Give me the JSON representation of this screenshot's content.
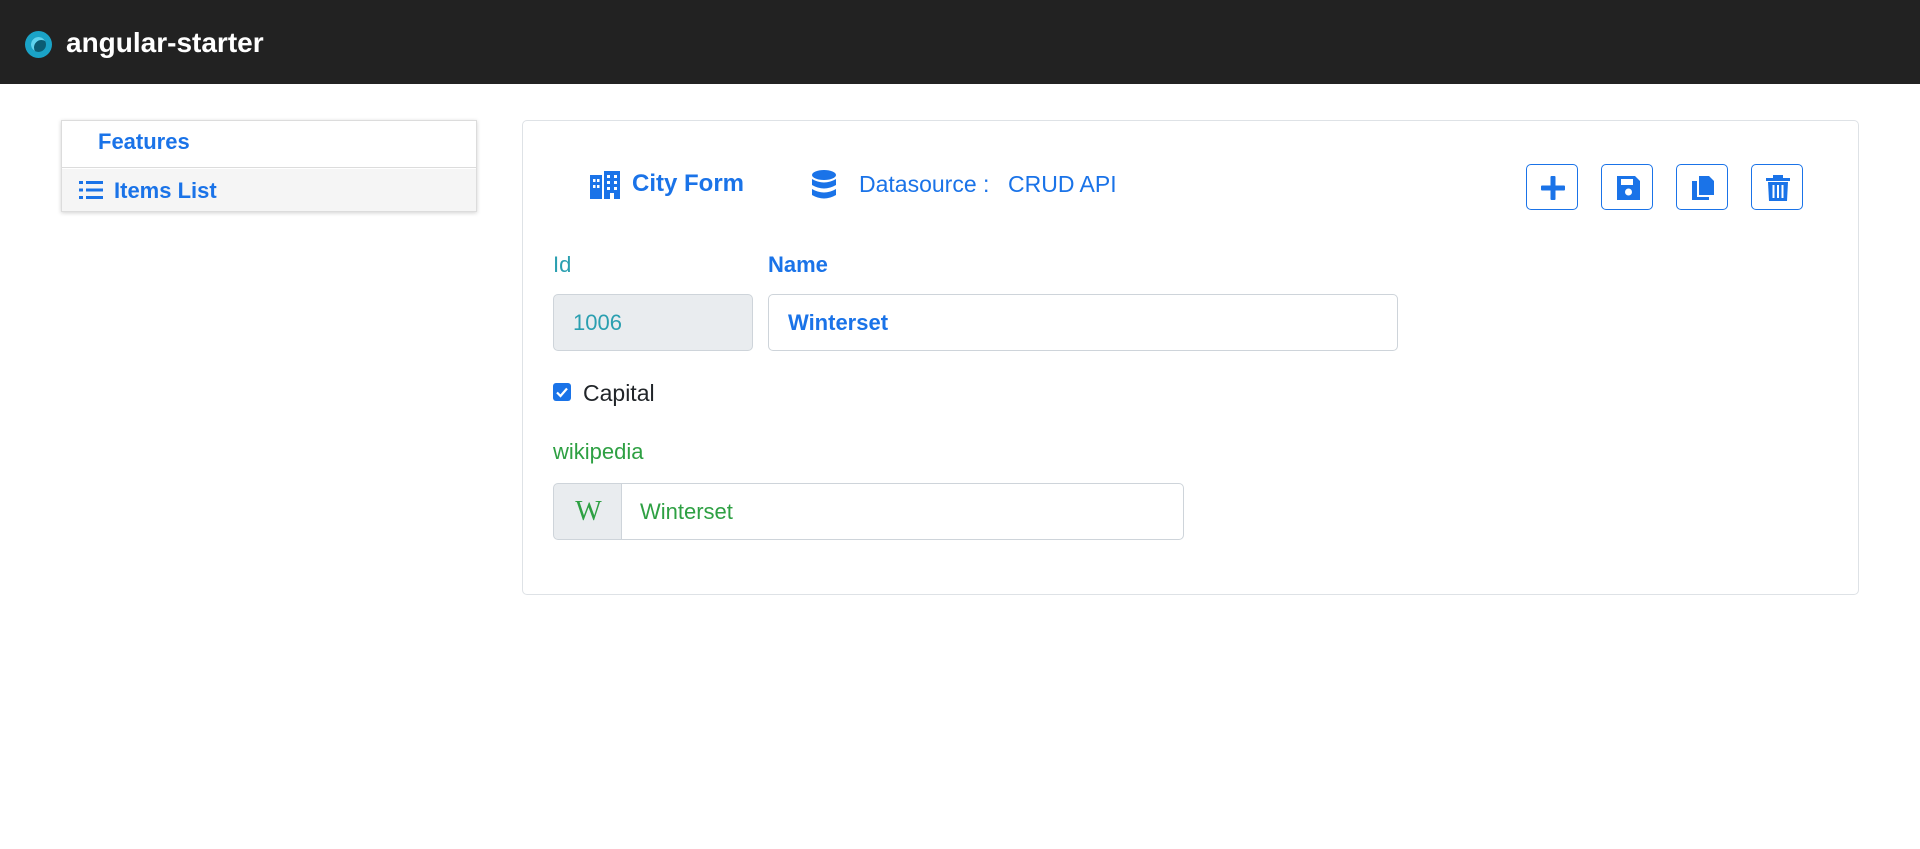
{
  "navbar": {
    "brand": "angular-starter",
    "logo_icon": "spiral-logo-icon"
  },
  "sidebar": {
    "header": "Features",
    "items": [
      {
        "label": "Items List",
        "icon": "list-icon"
      }
    ]
  },
  "form": {
    "title": "City Form",
    "title_icon": "city-icon",
    "datasource_label": "Datasource :",
    "datasource_value": "CRUD API",
    "datasource_icon": "database-icon",
    "toolbar": [
      {
        "name": "add-button",
        "icon": "plus-icon"
      },
      {
        "name": "save-button",
        "icon": "floppy-disk-icon"
      },
      {
        "name": "duplicate-button",
        "icon": "copy-icon"
      },
      {
        "name": "delete-button",
        "icon": "trash-icon"
      }
    ],
    "fields": {
      "id": {
        "label": "Id",
        "value": "1006"
      },
      "name": {
        "label": "Name",
        "value": "Winterset"
      },
      "capital": {
        "label": "Capital",
        "checked": true
      },
      "wikipedia": {
        "label": "wikipedia",
        "addon": "W",
        "value": "Winterset"
      }
    }
  },
  "colors": {
    "navbar_bg": "#222222",
    "primary": "#1a73e8",
    "teal": "#2a9fb0",
    "green": "#2ea043"
  }
}
